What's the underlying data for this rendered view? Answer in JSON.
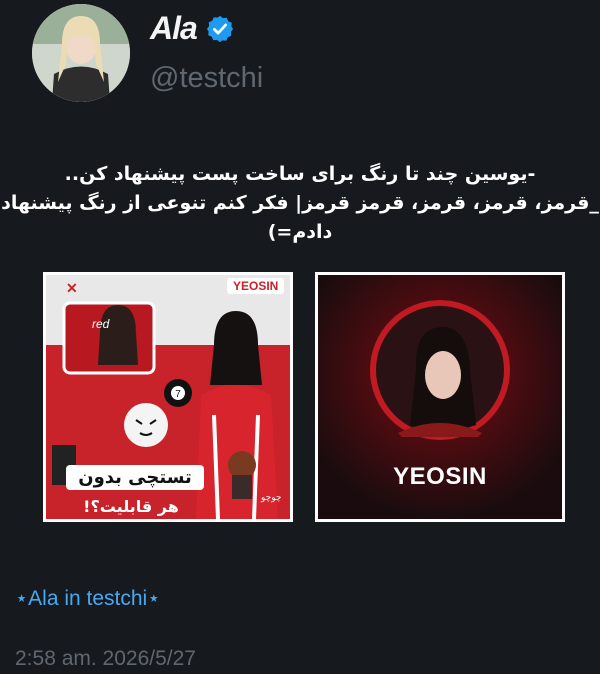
{
  "profile": {
    "name": "Ala",
    "handle": "@testchi"
  },
  "tweet": {
    "line1": "-یوسین چند تا رنگ برای ساخت پست پیشنهاد کن..",
    "line2": "_قرمز، قرمز، قرمز، قرمز قرمز| فکر کنم تنوعی از رنگ پیشنهاد دادم=)"
  },
  "media": [
    {
      "badge": "YEOSIN",
      "small_label": "red",
      "caption_top": "تستچی بدون",
      "caption_bottom": "هر قابلیت؟!",
      "sticker_text": "چوچو"
    },
    {
      "label": "YEOSIN"
    }
  ],
  "footer": {
    "tag": "⋆Ala in testchi⋆",
    "timestamp": "2:58 am. 2026/5/27"
  },
  "colors": {
    "background": "#16191e",
    "accent_blue": "#4aa8f0",
    "verified_blue": "#1d9bf0",
    "muted_text": "#5f6770",
    "media_red": "#c8222a"
  },
  "icons": [
    "verified-badge-icon"
  ]
}
